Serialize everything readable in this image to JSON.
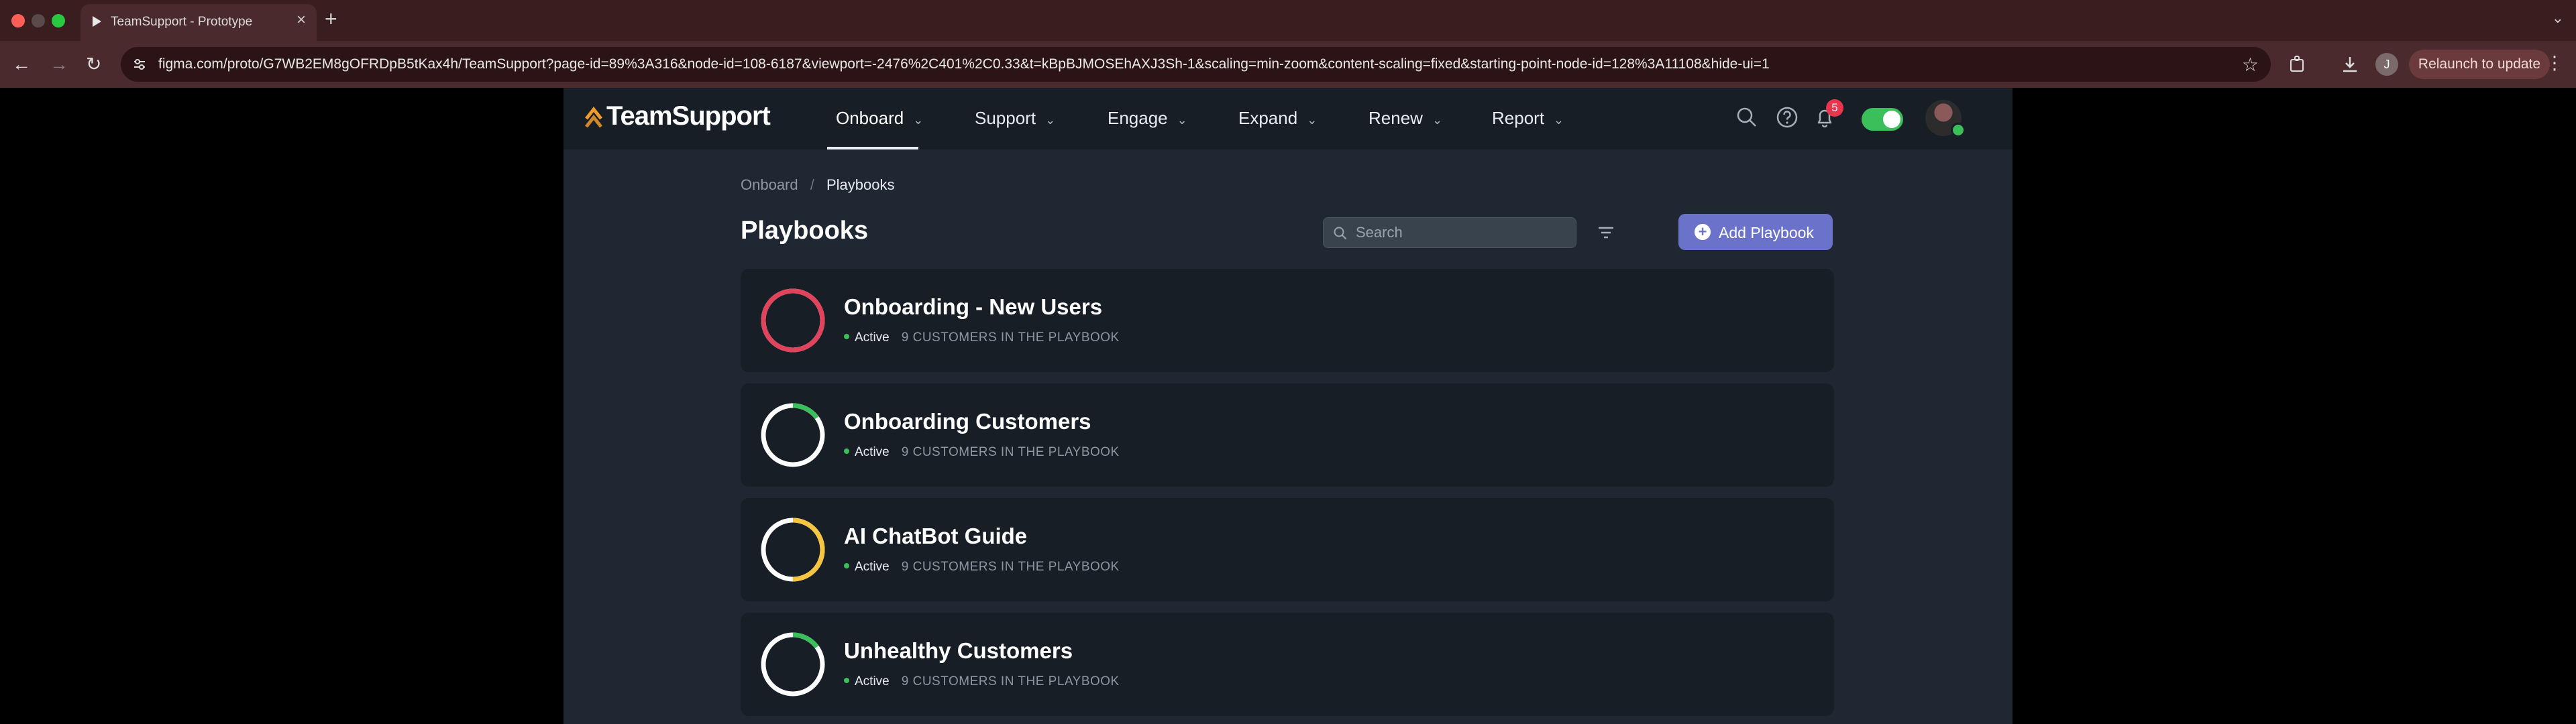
{
  "browser": {
    "tab_title": "TeamSupport - Prototype",
    "tab_close": "×",
    "new_tab": "+",
    "url": "figma.com/proto/G7WB2EM8gOFRDpB5tKax4h/TeamSupport?page-id=89%3A316&node-id=108-6187&viewport=-2476%2C401%2C0.33&t=kBpBJMOSEhAXJ3Sh-1&scaling=min-zoom&content-scaling=fixed&starting-point-node-id=128%3A11108&hide-ui=1",
    "profile_initial": "J",
    "relaunch_label": "Relaunch to update"
  },
  "app": {
    "brand": "TeamSupport",
    "nav": [
      {
        "label": "Onboard",
        "active": true
      },
      {
        "label": "Support"
      },
      {
        "label": "Engage"
      },
      {
        "label": "Expand"
      },
      {
        "label": "Renew"
      },
      {
        "label": "Report"
      }
    ],
    "notification_count": "5",
    "breadcrumb": {
      "parent": "Onboard",
      "separator": "/",
      "current": "Playbooks"
    },
    "page_title": "Playbooks",
    "search": {
      "placeholder": "Search"
    },
    "add_button_label": "Add Playbook",
    "playbooks": [
      {
        "title": "Onboarding - New Users",
        "status": "Active",
        "customers": "9 CUSTOMERS IN THE PLAYBOOK",
        "ring_color": "#e2435c",
        "progress": 1.0
      },
      {
        "title": "Onboarding Customers",
        "status": "Active",
        "customers": "9 CUSTOMERS IN THE PLAYBOOK",
        "ring_color": "#3bbf5a",
        "progress": 0.15
      },
      {
        "title": "AI ChatBot Guide",
        "status": "Active",
        "customers": "9 CUSTOMERS IN THE PLAYBOOK",
        "ring_color": "#f5c542",
        "progress": 0.5
      },
      {
        "title": "Unhealthy Customers",
        "status": "Active",
        "customers": "9 CUSTOMERS IN THE PLAYBOOK",
        "ring_color": "#3bbf5a",
        "progress": 0.15
      }
    ]
  }
}
